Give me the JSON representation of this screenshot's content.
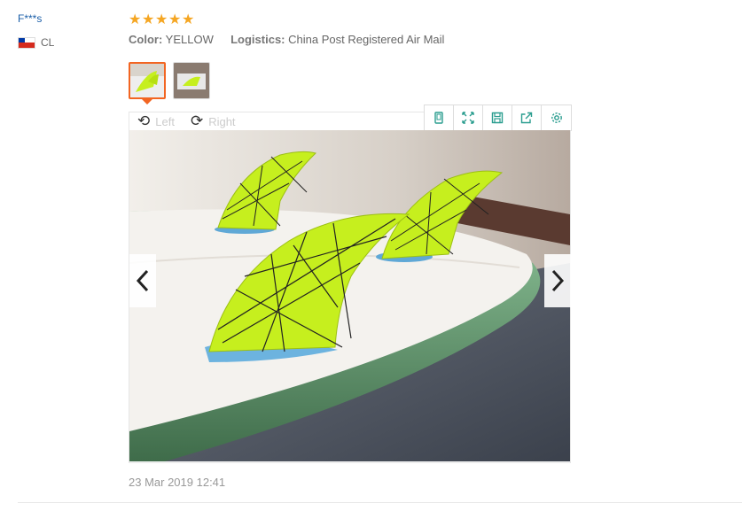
{
  "review": {
    "username": "F***s",
    "country_code": "CL",
    "rating": 5,
    "stars": [
      "★",
      "★",
      "★",
      "★",
      "★"
    ],
    "color_label": "Color:",
    "color_value": "YELLOW",
    "logistics_label": "Logistics:",
    "logistics_value": "China Post Registered Air Mail",
    "date": "23 Mar 2019 12:41"
  },
  "viewer": {
    "rotate_left_label": "Left",
    "rotate_right_label": "Right",
    "toolbar_icons": [
      "copy-icon",
      "fullscreen-icon",
      "save-icon",
      "share-icon",
      "settings-icon"
    ]
  },
  "colors": {
    "username": "#1a5ea8",
    "stars": "#f5a623",
    "thumb_active": "#f26522",
    "toolbar_icon": "#2a9d8f",
    "fin": "#c6ef1e"
  }
}
